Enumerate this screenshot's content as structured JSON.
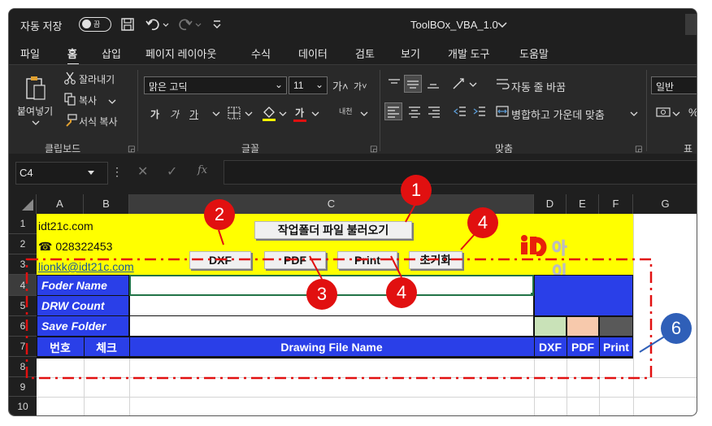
{
  "titlebar": {
    "autosave_label": "자동 저장",
    "autosave_state": "끔",
    "doc_title": "ToolBOx_VBA_1.0",
    "title_chevron": "chevron-down-icon"
  },
  "menu": {
    "items": [
      "파일",
      "홈",
      "삽입",
      "페이지 레이아웃",
      "수식",
      "데이터",
      "검토",
      "보기",
      "개발 도구",
      "도움말"
    ],
    "active": "홈"
  },
  "ribbon": {
    "clipboard": {
      "paste": "붙여넣기",
      "cut": "잘라내기",
      "copy": "복사",
      "format_painter": "서식 복사",
      "group": "클립보드"
    },
    "font": {
      "name": "맑은 고딕",
      "size": "11",
      "group": "글꼴",
      "grow_glyph": "가˄",
      "shrink_glyph": "가˅",
      "bold": "가",
      "italic": "가",
      "underline": "가",
      "phonetic": "내천"
    },
    "alignment": {
      "wrap": "자동 줄 바꿈",
      "merge": "병합하고 가운데 맞춤",
      "group": "맞춤"
    },
    "number": {
      "format": "일반",
      "group": "표시"
    }
  },
  "formula_bar": {
    "name_box": "C4",
    "fx": "fx",
    "formula": ""
  },
  "sheet": {
    "columns": [
      "A",
      "B",
      "C",
      "D",
      "E",
      "F",
      "G"
    ],
    "rows": [
      "1",
      "2",
      "3",
      "4",
      "5",
      "6",
      "7",
      "8",
      "9",
      "10"
    ],
    "header_info": {
      "site": "idt21c.com",
      "phone": "☎ 028322453",
      "email": "lionkk@idt21c.com"
    },
    "buttons": {
      "load_folder": "작업폴더 파일 불러오기",
      "dxf": "DXF",
      "pdf": "PDF",
      "print": "Print",
      "reset": "초기화"
    },
    "logo_text": "아이디티",
    "labels": {
      "folder_name": "Foder Name",
      "drw_count": "DRW Count",
      "save_folder": "Save Folder"
    },
    "table_header": {
      "no": "번호",
      "check": "체크",
      "file_name": "Drawing File Name",
      "dxf": "DXF",
      "pdf": "PDF",
      "print": "Print"
    },
    "status_colors": {
      "dxf": "#c9e2b8",
      "pdf": "#f7c9ac",
      "print": "#595959"
    }
  },
  "annotations": [
    "1",
    "2",
    "3",
    "4",
    "4",
    "6"
  ],
  "colors": {
    "accent_yellow": "#ffff00",
    "accent_blue": "#2a3fe8",
    "badge_red": "#e11010",
    "badge_blue": "#2f5fb8"
  }
}
